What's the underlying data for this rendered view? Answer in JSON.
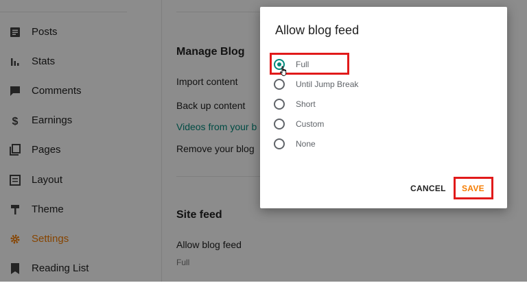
{
  "sidebar": {
    "items": [
      {
        "label": "Posts",
        "icon": "posts-icon"
      },
      {
        "label": "Stats",
        "icon": "stats-icon"
      },
      {
        "label": "Comments",
        "icon": "comments-icon"
      },
      {
        "label": "Earnings",
        "icon": "dollar-icon"
      },
      {
        "label": "Pages",
        "icon": "pages-icon"
      },
      {
        "label": "Layout",
        "icon": "layout-icon"
      },
      {
        "label": "Theme",
        "icon": "paint-roller-icon"
      },
      {
        "label": "Settings",
        "icon": "gear-icon",
        "active": true
      },
      {
        "label": "Reading List",
        "icon": "bookmark-icon"
      }
    ]
  },
  "main": {
    "manage_blog": {
      "title": "Manage Blog",
      "import_content": "Import content",
      "back_up_content": "Back up content",
      "videos_link": "Videos from your b",
      "remove_blog": "Remove your blog"
    },
    "site_feed": {
      "title": "Site feed",
      "allow_blog_feed_label": "Allow blog feed",
      "allow_blog_feed_value": "Full"
    }
  },
  "dialog": {
    "title": "Allow blog feed",
    "options": [
      "Full",
      "Until Jump Break",
      "Short",
      "Custom",
      "None"
    ],
    "selected": "Full",
    "cancel_label": "CANCEL",
    "save_label": "SAVE"
  },
  "colors": {
    "accent": "#f57c00",
    "radio_selected": "#00897b",
    "highlight": "#e11a1a",
    "link": "#00897b"
  }
}
